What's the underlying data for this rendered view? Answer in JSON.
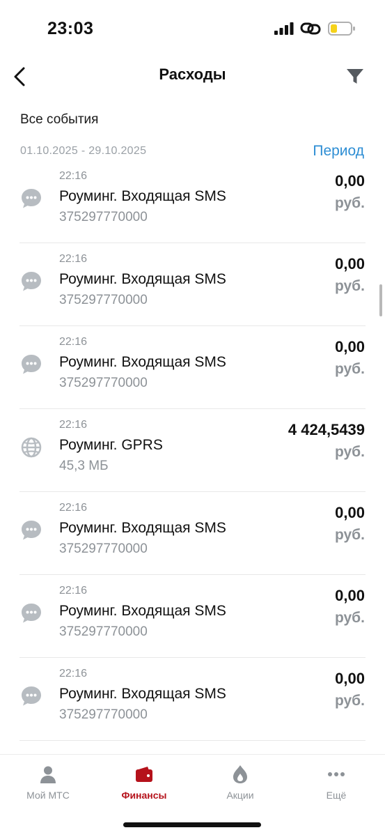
{
  "status_bar": {
    "time": "23:03"
  },
  "nav": {
    "title": "Расходы"
  },
  "filters": {
    "section_title": "Все события",
    "date_range": "01.10.2025 - 29.10.2025",
    "period_label": "Период"
  },
  "transactions": [
    {
      "time": "22:16",
      "name": "Роуминг. Входящая SMS",
      "sub": "375297770000",
      "amount": "0,00",
      "currency": "руб.",
      "icon": "sms-chat-icon"
    },
    {
      "time": "22:16",
      "name": "Роуминг. Входящая SMS",
      "sub": "375297770000",
      "amount": "0,00",
      "currency": "руб.",
      "icon": "sms-chat-icon"
    },
    {
      "time": "22:16",
      "name": "Роуминг. Входящая SMS",
      "sub": "375297770000",
      "amount": "0,00",
      "currency": "руб.",
      "icon": "sms-chat-icon"
    },
    {
      "time": "22:16",
      "name": "Роуминг. GPRS",
      "sub": "45,3 МБ",
      "amount": "4 424,5439",
      "currency": "руб.",
      "icon": "globe-icon"
    },
    {
      "time": "22:16",
      "name": "Роуминг. Входящая SMS",
      "sub": "375297770000",
      "amount": "0,00",
      "currency": "руб.",
      "icon": "sms-chat-icon"
    },
    {
      "time": "22:16",
      "name": "Роуминг. Входящая SMS",
      "sub": "375297770000",
      "amount": "0,00",
      "currency": "руб.",
      "icon": "sms-chat-icon"
    },
    {
      "time": "22:16",
      "name": "Роуминг. Входящая SMS",
      "sub": "375297770000",
      "amount": "0,00",
      "currency": "руб.",
      "icon": "sms-chat-icon"
    }
  ],
  "tabbar": {
    "items": [
      {
        "label": "Мой МТС",
        "icon": "person-icon",
        "active": false
      },
      {
        "label": "Финансы",
        "icon": "wallet-icon",
        "active": true
      },
      {
        "label": "Акции",
        "icon": "flame-icon",
        "active": false
      },
      {
        "label": "Ещё",
        "icon": "more-dots-icon",
        "active": false
      }
    ]
  },
  "colors": {
    "accent": "#b5121b",
    "link": "#2e8ed4",
    "muted": "#8d9297",
    "icon_gray": "#b7bcc1"
  }
}
